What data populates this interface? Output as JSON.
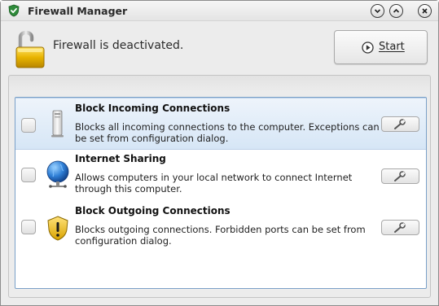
{
  "window": {
    "title": "Firewall Manager"
  },
  "header": {
    "status_text": "Firewall is deactivated.",
    "start_label": "Start"
  },
  "rules": [
    {
      "title": "Block Incoming Connections",
      "description": "Blocks all incoming connections to the computer. Exceptions can be set from configuration dialog.",
      "checked": false,
      "selected": true,
      "icon": "computer-tower-icon"
    },
    {
      "title": "Internet Sharing",
      "description": "Allows computers in your local network to connect Internet through this computer.",
      "checked": false,
      "selected": false,
      "icon": "globe-network-icon"
    },
    {
      "title": "Block Outgoing Connections",
      "description": "Blocks outgoing connections. Forbidden ports can be set from configuration dialog.",
      "checked": false,
      "selected": false,
      "icon": "warning-shield-icon"
    }
  ],
  "colors": {
    "selection": "#d6e6f6",
    "list_border": "#7aa0c8",
    "lock_gold": "#e8b400"
  }
}
